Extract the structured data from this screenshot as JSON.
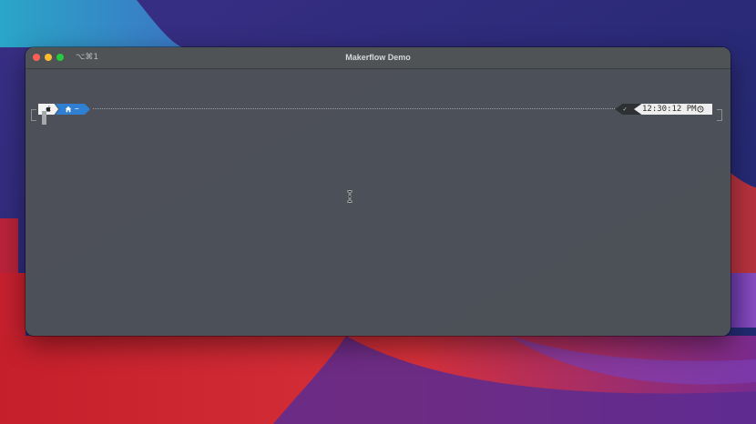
{
  "window": {
    "title": "Makerflow Demo",
    "shortcut": "⌥⌘1"
  },
  "prompt": {
    "directory": "~",
    "status": "✓",
    "time": "12:30:12 PM"
  },
  "icons": {
    "close": "close-icon",
    "minimize": "minimize-icon",
    "maximize": "maximize-icon",
    "os_logo": "apple-icon",
    "home": "home-icon",
    "clock": "clock-icon",
    "pointer": "ibeam-cursor-icon"
  },
  "colors": {
    "close": "#fe5f57",
    "minimize": "#febc2e",
    "maximize": "#28c840",
    "dir_segment": "#2f7fd3",
    "window_bg": "#4e5256"
  }
}
